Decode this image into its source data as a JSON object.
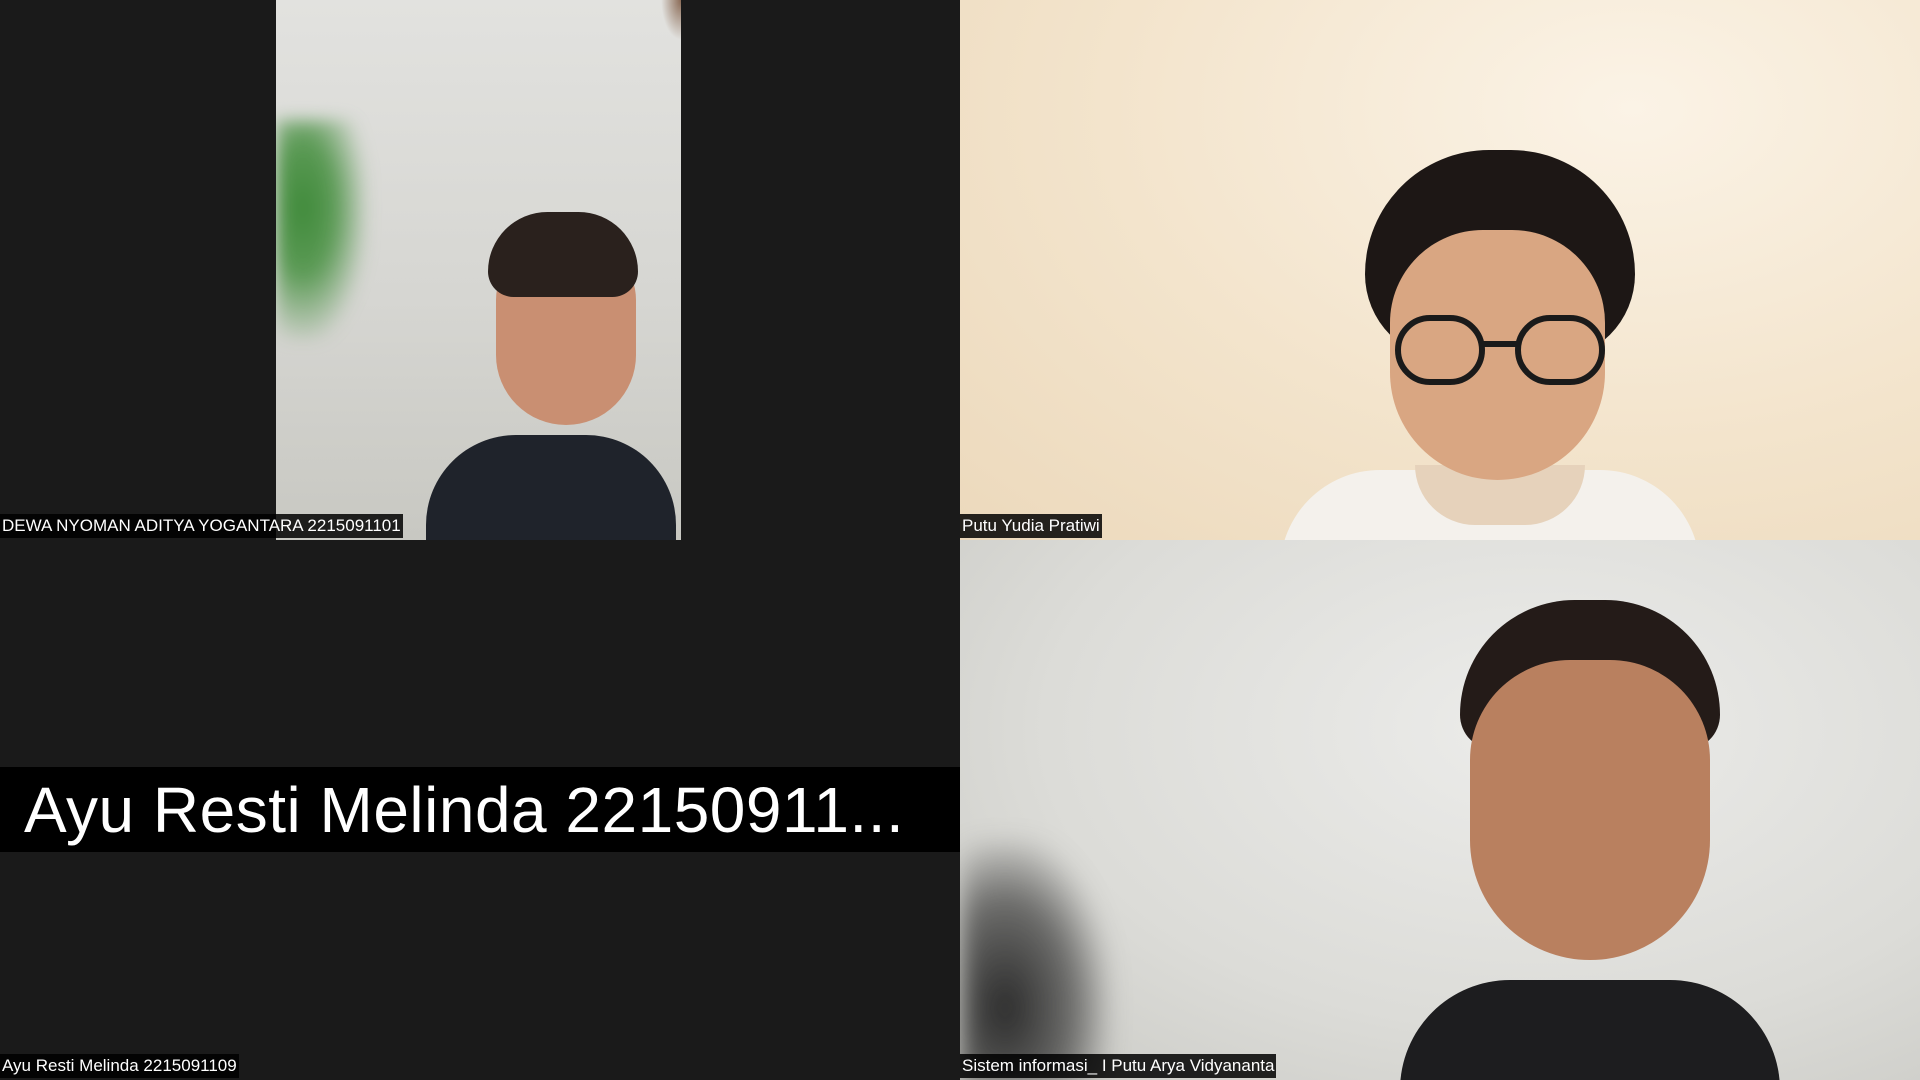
{
  "participants": [
    {
      "name": "DEWA NYOMAN ADITYA YOGANTARA 2215091101",
      "video": "on"
    },
    {
      "name": "Putu Yudia Pratiwi",
      "video": "on"
    },
    {
      "name": "Ayu Resti Melinda 2215091109",
      "display_name": "Ayu Resti Melinda 22150911...",
      "video": "off"
    },
    {
      "name": "Sistem informasi_ I Putu Arya Vidyananta",
      "video": "on"
    }
  ],
  "colors": {
    "background": "#1a1a1a",
    "label_bg": "#000000",
    "label_text": "#ffffff"
  }
}
